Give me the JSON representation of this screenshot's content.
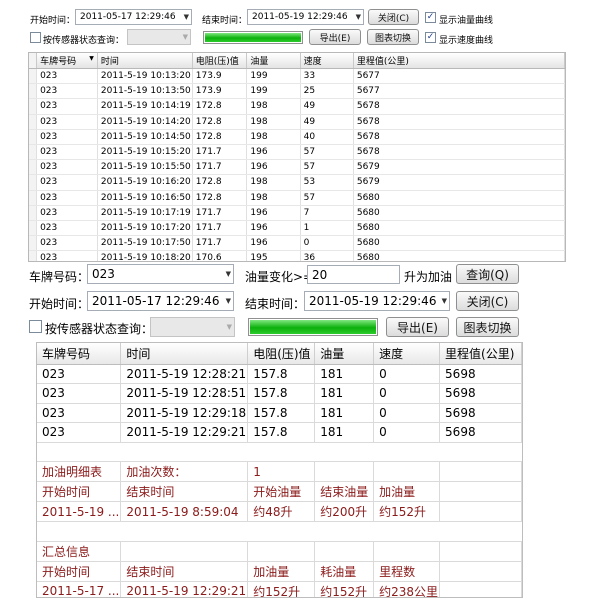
{
  "top_panel": {
    "start_label": "开始时间：",
    "start_value": "2011-05-17 12:29:46",
    "end_label": "结束时间：",
    "end_value": "2011-05-19 12:29:46",
    "close_button": "关闭(C)",
    "show_fuel_curve_label": "显示油量曲线",
    "sensor_query_label": "按传感器状态查询：",
    "export_button": "导出(E)",
    "chart_toggle_button": "图表切换",
    "show_speed_curve_label": "显示速度曲线",
    "columns": [
      "车牌号码",
      "时间",
      "电阻(压)值",
      "油量",
      "速度",
      "里程值(公里)"
    ],
    "rows": [
      [
        "023",
        "2011-5-19 10:13:20",
        "173.9",
        "199",
        "33",
        "5677"
      ],
      [
        "023",
        "2011-5-19 10:13:50",
        "173.9",
        "199",
        "25",
        "5677"
      ],
      [
        "023",
        "2011-5-19 10:14:19",
        "172.8",
        "198",
        "49",
        "5678"
      ],
      [
        "023",
        "2011-5-19 10:14:20",
        "172.8",
        "198",
        "49",
        "5678"
      ],
      [
        "023",
        "2011-5-19 10:14:50",
        "172.8",
        "198",
        "40",
        "5678"
      ],
      [
        "023",
        "2011-5-19 10:15:20",
        "171.7",
        "196",
        "57",
        "5678"
      ],
      [
        "023",
        "2011-5-19 10:15:50",
        "171.7",
        "196",
        "57",
        "5679"
      ],
      [
        "023",
        "2011-5-19 10:16:20",
        "172.8",
        "198",
        "53",
        "5679"
      ],
      [
        "023",
        "2011-5-19 10:16:50",
        "172.8",
        "198",
        "57",
        "5680"
      ],
      [
        "023",
        "2011-5-19 10:17:19",
        "171.7",
        "196",
        "7",
        "5680"
      ],
      [
        "023",
        "2011-5-19 10:17:20",
        "171.7",
        "196",
        "1",
        "5680"
      ],
      [
        "023",
        "2011-5-19 10:17:50",
        "171.7",
        "196",
        "0",
        "5680"
      ],
      [
        "023",
        "2011-5-19 10:18:20",
        "170.6",
        "195",
        "36",
        "5680"
      ]
    ]
  },
  "bottom_panel": {
    "plate_label": "车牌号码：",
    "plate_value": "023",
    "fuel_change_label": "油量变化>=",
    "fuel_change_value": "20",
    "fuel_change_suffix": "升为加油",
    "query_button": "查询(Q)",
    "start_label": "开始时间：",
    "start_value": "2011-05-17 12:29:46",
    "end_label": "结束时间：",
    "end_value": "2011-05-19 12:29:46",
    "close_button": "关闭(C)",
    "sensor_query_label": "按传感器状态查询：",
    "export_button": "导出(E)",
    "chart_toggle_button": "图表切换",
    "columns": [
      "车牌号码",
      "时间",
      "电阻(压)值",
      "油量",
      "速度",
      "里程值(公里)"
    ],
    "rows": [
      [
        "023",
        "2011-5-19 12:28:21",
        "157.8",
        "181",
        "0",
        "5698"
      ],
      [
        "023",
        "2011-5-19 12:28:51",
        "157.8",
        "181",
        "0",
        "5698"
      ],
      [
        "023",
        "2011-5-19 12:29:18",
        "157.8",
        "181",
        "0",
        "5698"
      ],
      [
        "023",
        "2011-5-19 12:29:21",
        "157.8",
        "181",
        "0",
        "5698"
      ]
    ],
    "refuel_title": "加油明细表",
    "refuel_count_label": "加油次数：",
    "refuel_count_value": "1",
    "refuel_headers": [
      "开始时间",
      "结束时间",
      "开始油量",
      "结束油量",
      "加油量"
    ],
    "refuel_row": [
      "2011-5-19 ...",
      "2011-5-19 8:59:04",
      "约48升",
      "约200升",
      "约152升"
    ],
    "summary_title": "汇总信息",
    "summary_headers": [
      "开始时间",
      "结束时间",
      "加油量",
      "耗油量",
      "里程数"
    ],
    "summary_row": [
      "2011-5-17 ...",
      "2011-5-19 12:29:21",
      "约152升",
      "约152升",
      "约238公里"
    ]
  },
  "colors": {
    "progress_green": "#0cb00c",
    "summary_text": "#8b1a1a"
  },
  "icons": {
    "dropdown": "▼",
    "check": "✓",
    "sort": "▼"
  }
}
